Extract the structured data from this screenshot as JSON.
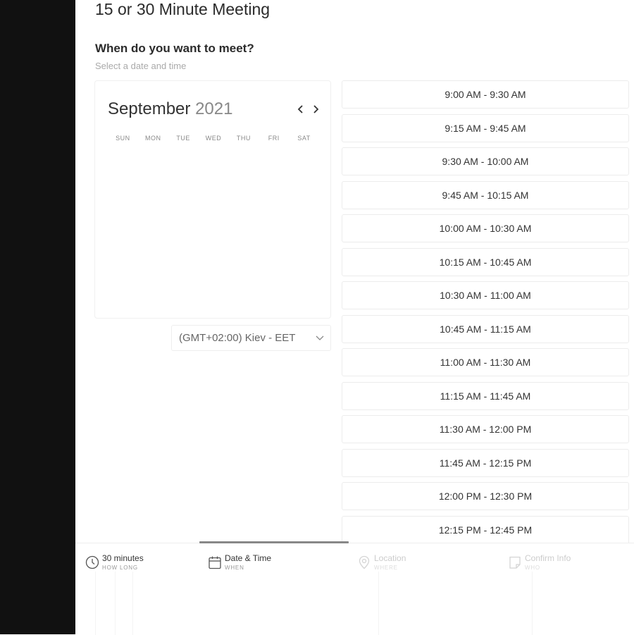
{
  "page": {
    "title": "15 or 30 Minute Meeting"
  },
  "section": {
    "title": "When do you want to meet?",
    "subtitle": "Select a date and time"
  },
  "calendar": {
    "month": "September",
    "year": "2021",
    "weekdays": [
      "SUN",
      "MON",
      "TUE",
      "WED",
      "THU",
      "FRI",
      "SAT"
    ],
    "prev_icon": "chevron-left-icon",
    "next_icon": "chevron-right-icon"
  },
  "timezone": {
    "selected": "(GMT+02:00) Kiev - EET",
    "icon": "chevron-down-icon"
  },
  "time_slots": [
    "9:00 AM - 9:30 AM",
    "9:15 AM - 9:45 AM",
    "9:30 AM - 10:00 AM",
    "9:45 AM - 10:15 AM",
    "10:00 AM - 10:30 AM",
    "10:15 AM - 10:45 AM",
    "10:30 AM - 11:00 AM",
    "10:45 AM - 11:15 AM",
    "11:00 AM - 11:30 AM",
    "11:15 AM - 11:45 AM",
    "11:30 AM - 12:00 PM",
    "11:45 AM - 12:15 PM",
    "12:00 PM - 12:30 PM",
    "12:15 PM - 12:45 PM"
  ],
  "steps": [
    {
      "title": "30 minutes",
      "subtitle": "HOW LONG",
      "icon": "clock-icon",
      "state": "done"
    },
    {
      "title": "Date & Time",
      "subtitle": "WHEN",
      "icon": "calendar-icon",
      "state": "active"
    },
    {
      "title": "Location",
      "subtitle": "WHERE",
      "icon": "location-pin-icon",
      "state": "upcoming"
    },
    {
      "title": "Confirm Info",
      "subtitle": "WHO",
      "icon": "form-icon",
      "state": "upcoming"
    }
  ],
  "colors": {
    "left_panel": "#111111",
    "background": "#ffffff",
    "slot_border": "#ececec",
    "progress": "#888888"
  }
}
